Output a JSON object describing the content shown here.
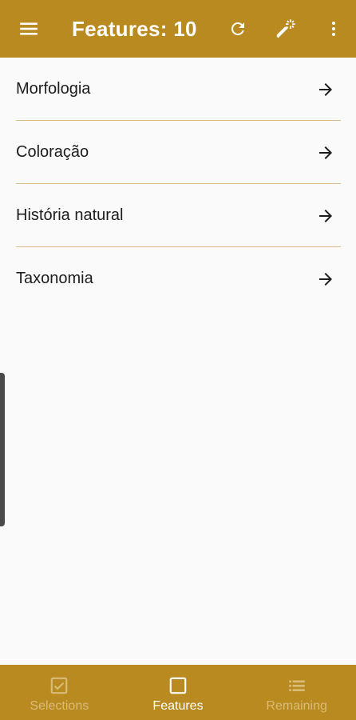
{
  "appbar": {
    "title": "Features: 10",
    "icons": [
      "menu-icon",
      "refresh-icon",
      "magic-wand-icon",
      "more-vert-icon"
    ]
  },
  "list": {
    "items": [
      {
        "label": "Morfologia"
      },
      {
        "label": "Coloração"
      },
      {
        "label": "História natural"
      },
      {
        "label": "Taxonomia"
      }
    ]
  },
  "bottom_nav": {
    "items": [
      {
        "label": "Selections",
        "icon": "checkbox-icon",
        "active": false
      },
      {
        "label": "Features",
        "icon": "square-icon",
        "active": true
      },
      {
        "label": "Remaining",
        "icon": "list-icon",
        "active": false
      }
    ]
  },
  "colors": {
    "primary": "#b98a1f",
    "divider": "#d9bf85",
    "nav_inactive": "#d9bc78",
    "nav_active": "#ffffff",
    "background": "#fafafa"
  }
}
